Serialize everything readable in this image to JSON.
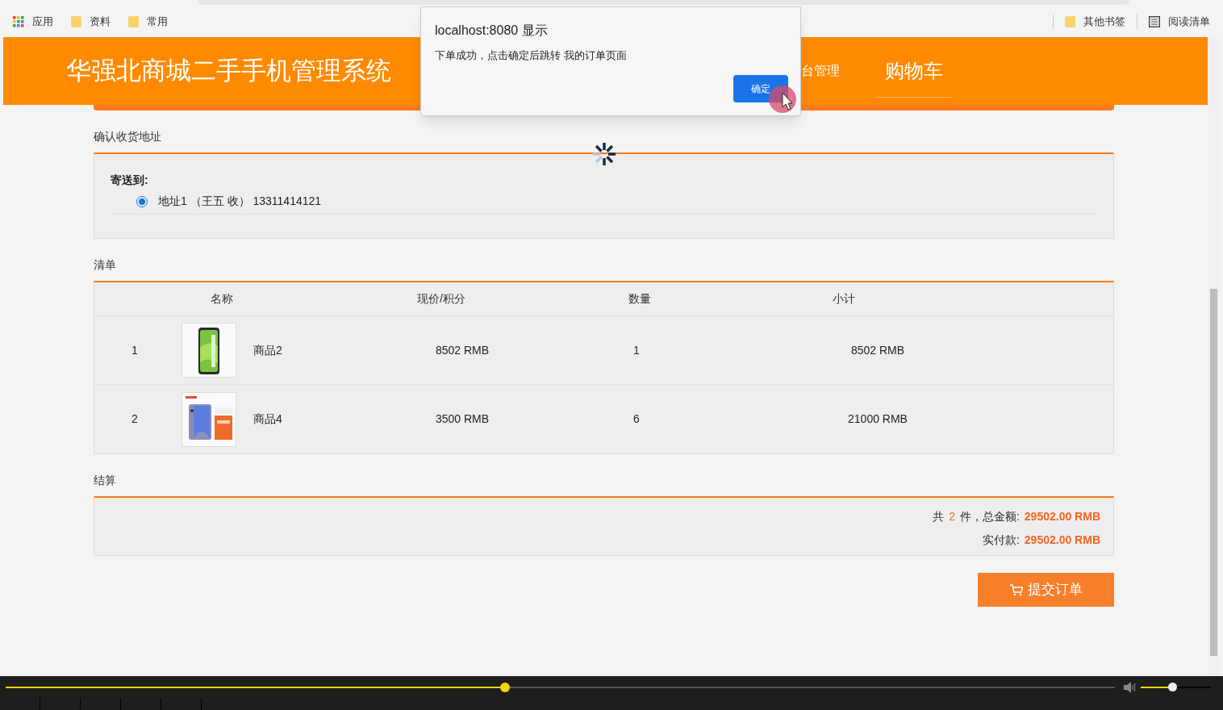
{
  "bookmarks_bar": {
    "left": [
      {
        "kind": "apps",
        "label": "应用"
      },
      {
        "kind": "folder",
        "label": "资料"
      },
      {
        "kind": "folder",
        "label": "常用"
      }
    ],
    "right": [
      {
        "kind": "folder",
        "label": "其他书签"
      },
      {
        "kind": "reading",
        "label": "阅读清单"
      }
    ]
  },
  "header": {
    "title": "华强北商城二手手机管理系统",
    "nav": [
      {
        "label": "台管理",
        "selected": false
      },
      {
        "label": "购物车",
        "selected": true
      }
    ]
  },
  "dialog": {
    "title": "localhost:8080 显示",
    "message": "下单成功，点击确定后跳转 我的订单页面",
    "button": "确定"
  },
  "address_section": {
    "title": "确认收货地址",
    "ship_to": "寄送到:",
    "addresses": [
      {
        "label": "地址1 （王五 收） 13311414121",
        "selected": true
      }
    ]
  },
  "list_section": {
    "title": "清单",
    "columns": [
      "名称",
      "现价/积分",
      "数量",
      "小计"
    ],
    "rows": [
      {
        "index": "1",
        "name": "商品2",
        "price": "8502 RMB",
        "quantity": "1",
        "subtotal": "8502 RMB"
      },
      {
        "index": "2",
        "name": "商品4",
        "price": "3500 RMB",
        "quantity": "6",
        "subtotal": "21000 RMB"
      }
    ]
  },
  "checkout_section": {
    "title": "结算",
    "count_prefix": "共",
    "count": "2",
    "count_suffix": "件，总金额:",
    "total": "29502.00 RMB",
    "paid_label": "实付款:",
    "paid": "29502.00 RMB"
  },
  "submit_button": "提交订单",
  "video_player": {
    "progress": {
      "level": 0.45
    },
    "volume": {
      "level": 0.45
    }
  }
}
